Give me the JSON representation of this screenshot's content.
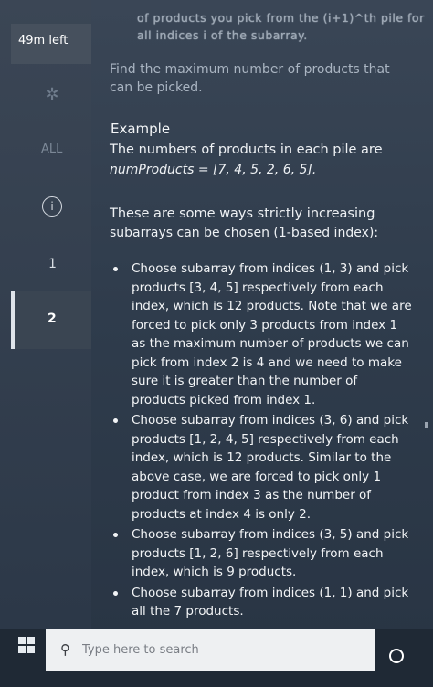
{
  "sidebar": {
    "timer": "49m left",
    "filter_all": "ALL",
    "info_icon": "info-icon",
    "items": [
      {
        "label": "1"
      },
      {
        "label": "2"
      }
    ]
  },
  "problem": {
    "faded_line_1": "of products you pick from the (i+1)^th pile for",
    "faded_line_2": "all indices i of the subarray.",
    "find_line_1": "Find the maximum number of products that",
    "find_line_2": "can be picked.",
    "example_title": "Example",
    "numbers_line_1": "The numbers of products in each pile are",
    "numbers_line_2": "numProducts = [7, 4, 5, 2, 6, 5].",
    "ways_line_1": "These are some ways strictly increasing",
    "ways_line_2": "subarrays can be chosen (1-based index):",
    "bullets": [
      "Choose subarray from indices (1, 3) and pick products [3, 4, 5] respectively from each index, which is 12 products. Note that we are forced to pick only 3 products from index 1 as the maximum number of products we can pick from index 2 is 4 and we need to make sure it is greater than the number of products picked from index 1.",
      "Choose subarray from indices (3, 6) and pick products [1, 2, 4, 5] respectively from each index, which is 12 products. Similar to the above case, we are forced to pick only 1 product from index 3 as the number of products at index 4 is only 2.",
      "Choose subarray from indices (3, 5) and pick products [1, 2, 6] respectively from each index, which is 9 products.",
      "Choose subarray from indices (1, 1) and pick all the 7 products."
    ]
  },
  "taskbar": {
    "search_placeholder": "Type here to search"
  }
}
